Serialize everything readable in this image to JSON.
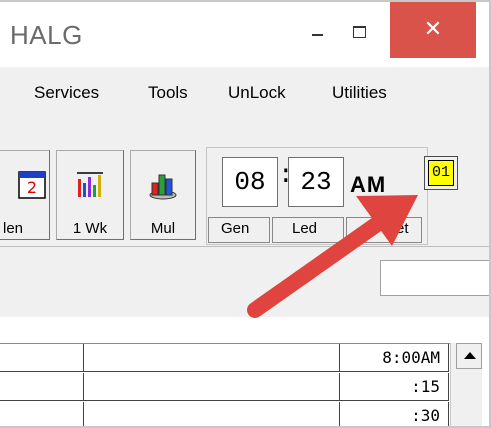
{
  "window": {
    "title": "HALG",
    "close_glyph": "✕"
  },
  "menu": {
    "items": [
      "Services",
      "Tools",
      "UnLock",
      "Utilities"
    ]
  },
  "toolbar": {
    "buttons": [
      {
        "label": "len",
        "icon": "calendar-day-icon"
      },
      {
        "label": "1 Wk",
        "icon": "week-bar-chart-icon"
      },
      {
        "label": "Mul",
        "icon": "multi-chart-icon"
      }
    ],
    "sub_buttons": [
      "Gen",
      "Led",
      "et"
    ]
  },
  "clock": {
    "hour": "08",
    "minute": "23",
    "colon": ":",
    "ampm": "AM"
  },
  "indicator": {
    "value": "01",
    "color": "#ffff00"
  },
  "grid": {
    "rows": [
      {
        "time": "8:00AM"
      },
      {
        "time": ":15"
      },
      {
        "time": ":30"
      }
    ]
  },
  "annotation": {
    "arrow_color": "#e0443e"
  }
}
